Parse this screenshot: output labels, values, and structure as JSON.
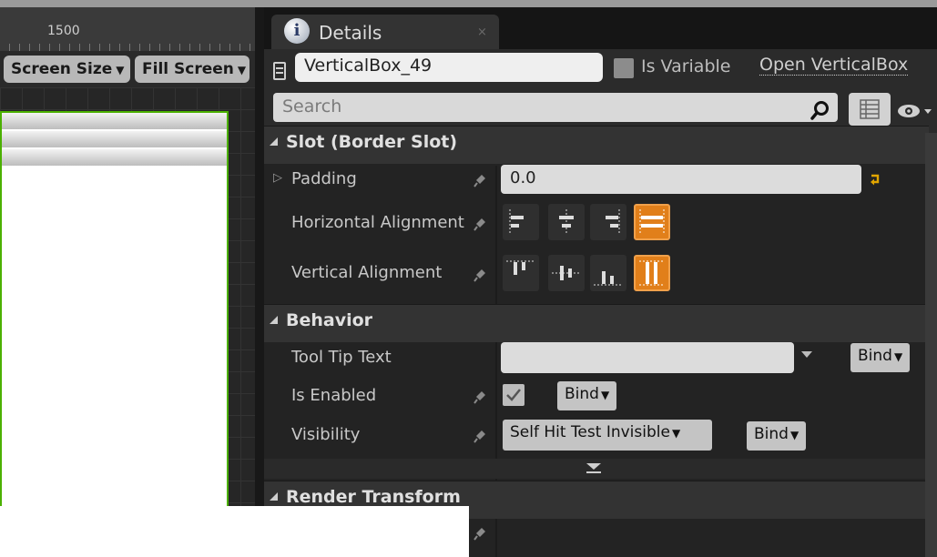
{
  "designer": {
    "ruler_label": "1500",
    "screen_size_label": "Screen Size",
    "fill_screen_label": "Fill Screen"
  },
  "details": {
    "tab_title": "Details",
    "tab_close": "×",
    "info_icon_text": "i",
    "widget_name": "VerticalBox_49",
    "is_variable_label": "Is Variable",
    "open_link": "Open VerticalBox",
    "search_placeholder": "Search"
  },
  "sections": {
    "slot": {
      "title": "Slot (Border Slot)",
      "padding_label": "Padding",
      "padding_value": "0.0",
      "halign_label": "Horizontal Alignment",
      "valign_label": "Vertical Alignment",
      "halign_selected": "fill",
      "valign_selected": "fill"
    },
    "behavior": {
      "title": "Behavior",
      "tooltip_label": "Tool Tip Text",
      "tooltip_value": "",
      "enabled_label": "Is Enabled",
      "enabled": true,
      "visibility_label": "Visibility",
      "visibility_value": "Self Hit Test Invisible",
      "bind_label": "Bind"
    },
    "render": {
      "title": "Render Transform"
    }
  },
  "colors": {
    "accent": "#e17f1a",
    "canvas_border": "#4bb000"
  }
}
